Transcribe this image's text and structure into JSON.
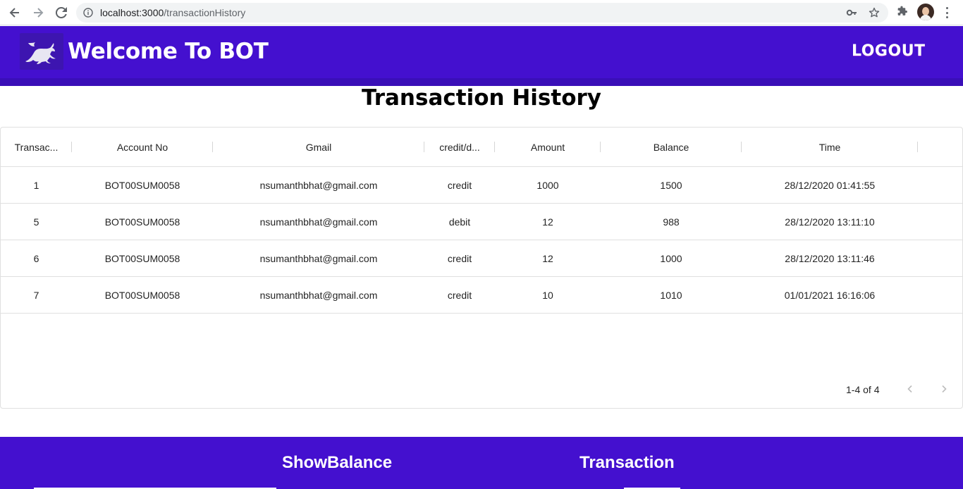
{
  "browser": {
    "url_host": "localhost:3000",
    "url_path": "/transactionHistory"
  },
  "header": {
    "title": "Welcome To BOT",
    "logout_label": "LOGOUT"
  },
  "page": {
    "title": "Transaction History"
  },
  "table": {
    "columns": [
      "Transac...",
      "Account No",
      "Gmail",
      "credit/d...",
      "Amount",
      "Balance",
      "Time"
    ],
    "rows": [
      [
        "1",
        "BOT00SUM0058",
        "nsumanthbhat@gmail.com",
        "credit",
        "1000",
        "1500",
        "28/12/2020 01:41:55"
      ],
      [
        "5",
        "BOT00SUM0058",
        "nsumanthbhat@gmail.com",
        "debit",
        "12",
        "988",
        "28/12/2020 13:11:10"
      ],
      [
        "6",
        "BOT00SUM0058",
        "nsumanthbhat@gmail.com",
        "credit",
        "12",
        "1000",
        "28/12/2020 13:11:46"
      ],
      [
        "7",
        "BOT00SUM0058",
        "nsumanthbhat@gmail.com",
        "credit",
        "10",
        "1010",
        "01/01/2021 16:16:06"
      ]
    ],
    "pagination": "1-4 of 4"
  },
  "footer": {
    "links": [
      "ShowBalance",
      "Transaction"
    ]
  },
  "colors": {
    "brand": "#4410cf",
    "text": "#000000"
  },
  "icons": [
    "back-icon",
    "forward-icon",
    "reload-icon",
    "info-icon",
    "key-icon",
    "star-icon",
    "puzzle-icon",
    "profile-avatar",
    "menu-icon",
    "bull-logo",
    "chevron-left-icon",
    "chevron-right-icon"
  ]
}
